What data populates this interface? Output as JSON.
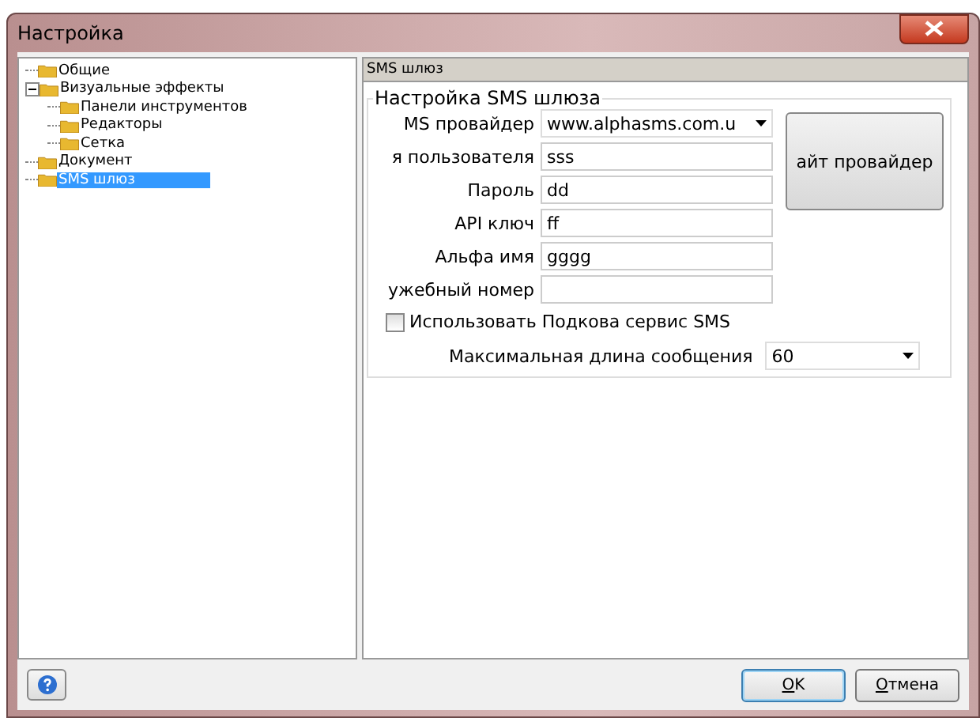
{
  "window": {
    "title": "Настройка"
  },
  "tree": [
    {
      "label": "Общие",
      "selected": false
    },
    {
      "label": "Визуальные эффекты",
      "selected": false,
      "expanded": true,
      "children": [
        {
          "label": "Панели инструментов",
          "selected": false
        },
        {
          "label": "Редакторы",
          "selected": false
        },
        {
          "label": "Сетка",
          "selected": false
        }
      ]
    },
    {
      "label": "Документ",
      "selected": false
    },
    {
      "label": "SMS шлюз",
      "selected": true
    }
  ],
  "panel": {
    "header": "SMS шлюз",
    "group_title": "Настройка SMS шлюза",
    "fields": [
      {
        "label": "MS провайдер",
        "kind": "dropdown",
        "value": "www.alphasms.com.u"
      },
      {
        "label": "я пользователя",
        "kind": "text",
        "value": "sss"
      },
      {
        "label": "Пароль",
        "kind": "text",
        "value": "dd"
      },
      {
        "label": "API ключ",
        "kind": "text",
        "value": "ff"
      },
      {
        "label": "Альфа имя",
        "kind": "text",
        "value": "gggg"
      },
      {
        "label": "ужебный номер",
        "kind": "text"
      }
    ],
    "site_button": "айт провайдер",
    "checkbox": {
      "label": "Использовать Подкова сервис SMS",
      "checked": false
    },
    "max_length": {
      "label": "Максимальная длина сообщения",
      "value": "60"
    }
  },
  "buttons": [
    {
      "label": "OK",
      "default": true
    },
    {
      "label": "Отмена",
      "default": false
    }
  ]
}
